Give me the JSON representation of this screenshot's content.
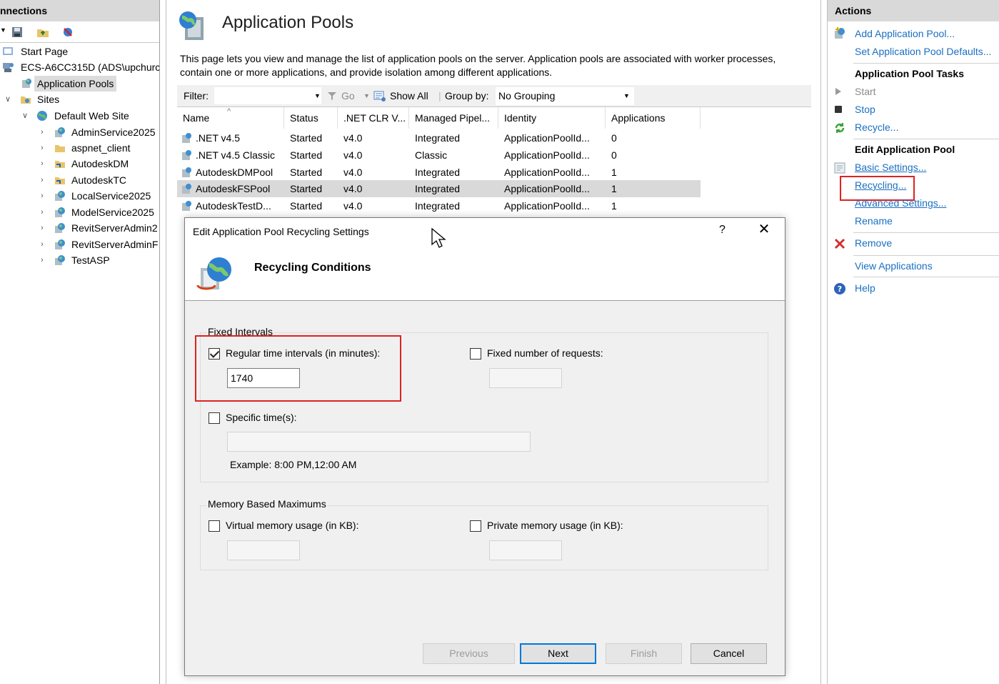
{
  "connections": {
    "title": "nnections",
    "tree": [
      {
        "label": "Start Page"
      },
      {
        "label": "ECS-A6CC315D (ADS\\upchurc"
      },
      {
        "label": "Application Pools"
      },
      {
        "label": "Sites"
      },
      {
        "label": "Default Web Site"
      },
      {
        "label": "AdminService2025"
      },
      {
        "label": "aspnet_client"
      },
      {
        "label": "AutodeskDM"
      },
      {
        "label": "AutodeskTC"
      },
      {
        "label": "LocalService2025"
      },
      {
        "label": "ModelService2025"
      },
      {
        "label": "RevitServerAdmin2"
      },
      {
        "label": "RevitServerAdminF"
      },
      {
        "label": "TestASP"
      }
    ]
  },
  "main": {
    "title": "Application Pools",
    "description": "This page lets you view and manage the list of application pools on the server. Application pools are associated with worker processes, contain one or more applications, and provide isolation among different applications.",
    "filter_label": "Filter:",
    "go_label": "Go",
    "show_all_label": "Show All",
    "group_by_label": "Group by:",
    "group_by_value": "No Grouping",
    "columns": [
      "Name",
      "Status",
      ".NET CLR V...",
      "Managed Pipel...",
      "Identity",
      "Applications"
    ],
    "rows": [
      [
        ".NET v4.5",
        "Started",
        "v4.0",
        "Integrated",
        "ApplicationPoolId...",
        "0"
      ],
      [
        ".NET v4.5 Classic",
        "Started",
        "v4.0",
        "Classic",
        "ApplicationPoolId...",
        "0"
      ],
      [
        "AutodeskDMPool",
        "Started",
        "v4.0",
        "Integrated",
        "ApplicationPoolId...",
        "1"
      ],
      [
        "AutodeskFSPool",
        "Started",
        "v4.0",
        "Integrated",
        "ApplicationPoolId...",
        "1"
      ],
      [
        "AutodeskTestD...",
        "Started",
        "v4.0",
        "Integrated",
        "ApplicationPoolId...",
        "1"
      ]
    ]
  },
  "actions": {
    "title": "Actions",
    "add_pool": "Add Application Pool...",
    "set_defaults": "Set Application Pool Defaults...",
    "tasks_heading": "Application Pool Tasks",
    "start": "Start",
    "stop": "Stop",
    "recycle": "Recycle...",
    "edit_heading": "Edit Application Pool",
    "basic_settings": "Basic Settings...",
    "recycling": "Recycling...",
    "advanced_settings": "Advanced Settings...",
    "rename": "Rename",
    "remove": "Remove",
    "view_applications": "View Applications",
    "help": "Help"
  },
  "dialog": {
    "title": "Edit Application Pool Recycling Settings",
    "help_glyph": "?",
    "close_glyph": "✕",
    "heading": "Recycling Conditions",
    "fixed_intervals_label": "Fixed Intervals",
    "regular_time_label": "Regular time intervals (in minutes):",
    "regular_time_checked": true,
    "regular_time_value": "1740",
    "fixed_requests_label": "Fixed number of requests:",
    "fixed_requests_checked": false,
    "specific_times_label": "Specific time(s):",
    "specific_times_checked": false,
    "example_text": "Example: 8:00 PM,12:00 AM",
    "memory_label": "Memory Based Maximums",
    "virtual_memory_label": "Virtual memory usage (in KB):",
    "private_memory_label": "Private memory usage (in KB):",
    "buttons": {
      "previous": "Previous",
      "next": "Next",
      "finish": "Finish",
      "cancel": "Cancel"
    }
  },
  "colors": {
    "link": "#1a6fc1",
    "highlight_box": "#dd2222",
    "header_gray": "#d9d9d9"
  }
}
